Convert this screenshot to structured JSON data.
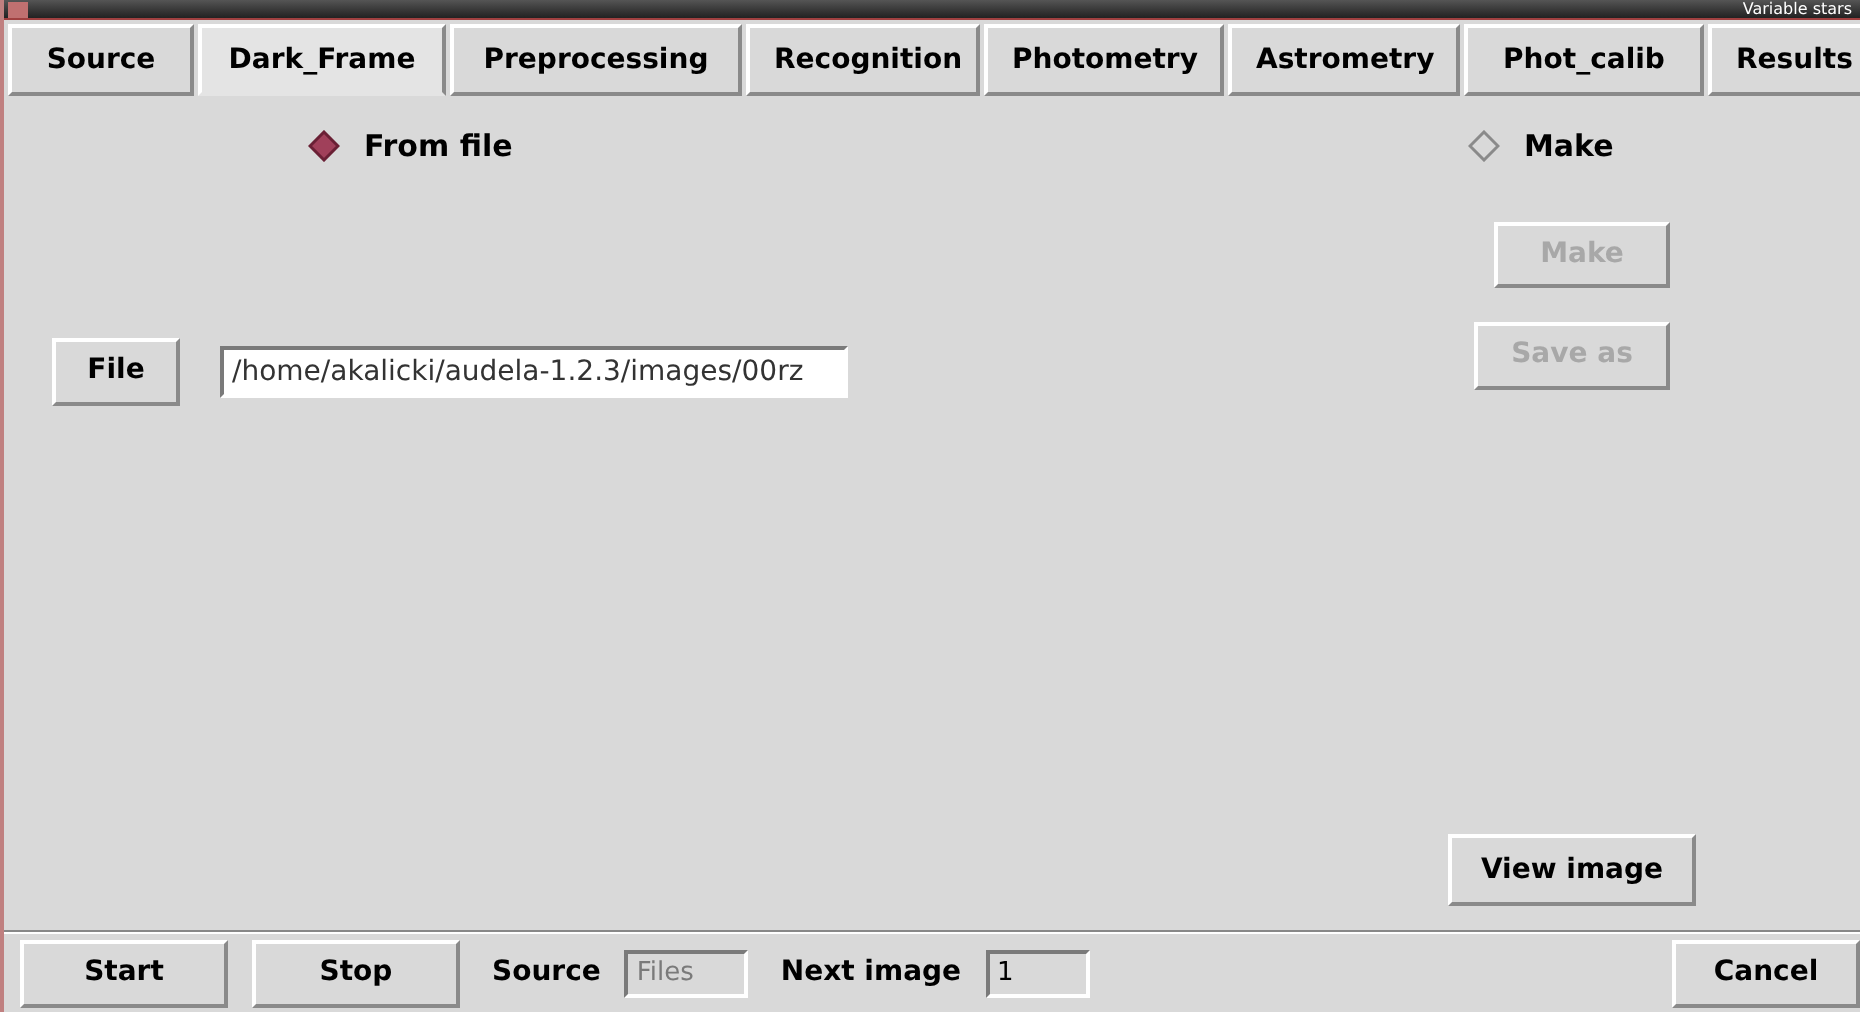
{
  "window": {
    "title": "Variable stars"
  },
  "tabs": [
    {
      "label": "Source",
      "selected": false
    },
    {
      "label": "Dark_Frame",
      "selected": true
    },
    {
      "label": "Preprocessing",
      "selected": false
    },
    {
      "label": "Recognition",
      "selected": false
    },
    {
      "label": "Photometry",
      "selected": false
    },
    {
      "label": "Astrometry",
      "selected": false
    },
    {
      "label": "Phot_calib",
      "selected": false
    },
    {
      "label": "Results",
      "selected": false
    }
  ],
  "radios": [
    {
      "label": "From file",
      "selected": true
    },
    {
      "label": "Make",
      "selected": false
    }
  ],
  "make_buttons": [
    {
      "label": "Make",
      "disabled": true
    },
    {
      "label": "Save as",
      "disabled": true
    }
  ],
  "file": {
    "button": "File",
    "value": "/home/akalicki/audela-1.2.3/images/00rz"
  },
  "view_button": "View image",
  "bottom": {
    "start": "Start",
    "stop": "Stop",
    "source_label": "Source",
    "source_value": "Files",
    "source_disabled": true,
    "next_label": "Next image",
    "next_value": "1",
    "cancel": "Cancel"
  }
}
